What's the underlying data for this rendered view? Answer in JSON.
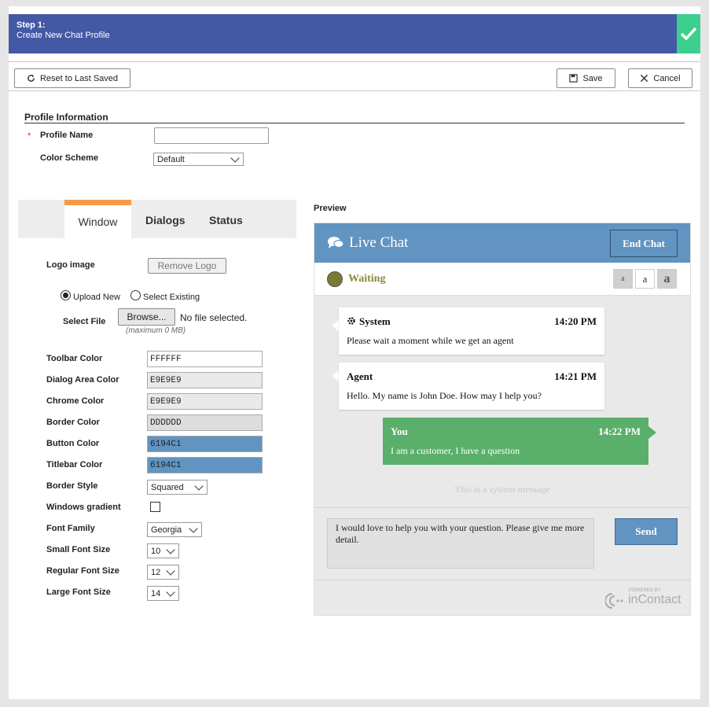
{
  "step": {
    "title": "Step 1:",
    "subtitle": "Create New Chat Profile"
  },
  "toolbar": {
    "reset_label": "Reset to Last Saved",
    "save_label": "Save",
    "cancel_label": "Cancel"
  },
  "profile": {
    "section_title": "Profile Information",
    "required_marker": "*",
    "name_label": "Profile Name",
    "name_value": "",
    "scheme_label": "Color Scheme",
    "scheme_value": "Default"
  },
  "tabs": [
    {
      "label": "Window",
      "active": true
    },
    {
      "label": "Dialogs",
      "active": false
    },
    {
      "label": "Status",
      "active": false
    }
  ],
  "window": {
    "logo_label": "Logo image",
    "remove_logo": "Remove Logo",
    "upload_new": "Upload New",
    "select_existing": "Select Existing",
    "upload_selected": "upload-new",
    "select_file_label": "Select File",
    "browse_label": "Browse...",
    "no_file": "No file selected.",
    "max_note": "(maximum 0 MB)",
    "colors": [
      {
        "label": "Toolbar Color",
        "value": "FFFFFF",
        "swatch": "#FFFFFF"
      },
      {
        "label": "Dialog Area Color",
        "value": "E9E9E9",
        "swatch": "#E9E9E9"
      },
      {
        "label": "Chrome Color",
        "value": "E9E9E9",
        "swatch": "#E9E9E9"
      },
      {
        "label": "Border Color",
        "value": "DDDDDD",
        "swatch": "#DDDDDD"
      },
      {
        "label": "Button Color",
        "value": "6194C1",
        "swatch": "#6194C1"
      },
      {
        "label": "Titlebar Color",
        "value": "6194C1",
        "swatch": "#6194C1"
      }
    ],
    "border_style_label": "Border Style",
    "border_style_value": "Squared",
    "gradient_label": "Windows gradient",
    "gradient_checked": false,
    "font_family_label": "Font Family",
    "font_family_value": "Georgia",
    "small_font_label": "Small Font Size",
    "small_font_value": "10",
    "regular_font_label": "Regular Font Size",
    "regular_font_value": "12",
    "large_font_label": "Large Font Size",
    "large_font_value": "14"
  },
  "preview": {
    "label": "Preview",
    "title": "Live Chat",
    "end_chat": "End Chat",
    "status": "Waiting",
    "font_buttons": [
      "a",
      "a",
      "a"
    ],
    "messages": [
      {
        "name": "System",
        "time": "14:20 PM",
        "text": "Please wait a moment while we get an agent"
      },
      {
        "name": "Agent",
        "time": "14:21 PM",
        "text": "Hello. My name is John Doe. How may I help you?"
      },
      {
        "name": "You",
        "time": "14:22 PM",
        "text": "I am a customer, I have a question"
      }
    ],
    "system_message": "This is a system message",
    "input_text": "I would love to help you with your question. Please give me more detail.",
    "send_label": "Send",
    "powered_by": "POWERED BY",
    "brand": "inContact"
  },
  "colors": {
    "header": "#4359A5",
    "check": "#3DCF8E",
    "tab_accent": "#F69A47",
    "titlebar": "#6194C1",
    "you_bubble": "#5AB06A"
  }
}
